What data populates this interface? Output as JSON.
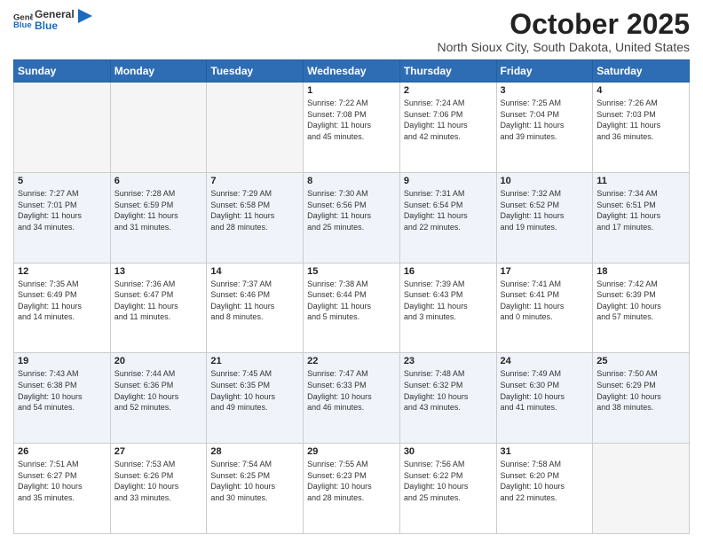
{
  "header": {
    "logo_line1": "General",
    "logo_line2": "Blue",
    "title": "October 2025",
    "subtitle": "North Sioux City, South Dakota, United States"
  },
  "days_of_week": [
    "Sunday",
    "Monday",
    "Tuesday",
    "Wednesday",
    "Thursday",
    "Friday",
    "Saturday"
  ],
  "weeks": [
    [
      {
        "day": "",
        "info": ""
      },
      {
        "day": "",
        "info": ""
      },
      {
        "day": "",
        "info": ""
      },
      {
        "day": "1",
        "info": "Sunrise: 7:22 AM\nSunset: 7:08 PM\nDaylight: 11 hours\nand 45 minutes."
      },
      {
        "day": "2",
        "info": "Sunrise: 7:24 AM\nSunset: 7:06 PM\nDaylight: 11 hours\nand 42 minutes."
      },
      {
        "day": "3",
        "info": "Sunrise: 7:25 AM\nSunset: 7:04 PM\nDaylight: 11 hours\nand 39 minutes."
      },
      {
        "day": "4",
        "info": "Sunrise: 7:26 AM\nSunset: 7:03 PM\nDaylight: 11 hours\nand 36 minutes."
      }
    ],
    [
      {
        "day": "5",
        "info": "Sunrise: 7:27 AM\nSunset: 7:01 PM\nDaylight: 11 hours\nand 34 minutes."
      },
      {
        "day": "6",
        "info": "Sunrise: 7:28 AM\nSunset: 6:59 PM\nDaylight: 11 hours\nand 31 minutes."
      },
      {
        "day": "7",
        "info": "Sunrise: 7:29 AM\nSunset: 6:58 PM\nDaylight: 11 hours\nand 28 minutes."
      },
      {
        "day": "8",
        "info": "Sunrise: 7:30 AM\nSunset: 6:56 PM\nDaylight: 11 hours\nand 25 minutes."
      },
      {
        "day": "9",
        "info": "Sunrise: 7:31 AM\nSunset: 6:54 PM\nDaylight: 11 hours\nand 22 minutes."
      },
      {
        "day": "10",
        "info": "Sunrise: 7:32 AM\nSunset: 6:52 PM\nDaylight: 11 hours\nand 19 minutes."
      },
      {
        "day": "11",
        "info": "Sunrise: 7:34 AM\nSunset: 6:51 PM\nDaylight: 11 hours\nand 17 minutes."
      }
    ],
    [
      {
        "day": "12",
        "info": "Sunrise: 7:35 AM\nSunset: 6:49 PM\nDaylight: 11 hours\nand 14 minutes."
      },
      {
        "day": "13",
        "info": "Sunrise: 7:36 AM\nSunset: 6:47 PM\nDaylight: 11 hours\nand 11 minutes."
      },
      {
        "day": "14",
        "info": "Sunrise: 7:37 AM\nSunset: 6:46 PM\nDaylight: 11 hours\nand 8 minutes."
      },
      {
        "day": "15",
        "info": "Sunrise: 7:38 AM\nSunset: 6:44 PM\nDaylight: 11 hours\nand 5 minutes."
      },
      {
        "day": "16",
        "info": "Sunrise: 7:39 AM\nSunset: 6:43 PM\nDaylight: 11 hours\nand 3 minutes."
      },
      {
        "day": "17",
        "info": "Sunrise: 7:41 AM\nSunset: 6:41 PM\nDaylight: 11 hours\nand 0 minutes."
      },
      {
        "day": "18",
        "info": "Sunrise: 7:42 AM\nSunset: 6:39 PM\nDaylight: 10 hours\nand 57 minutes."
      }
    ],
    [
      {
        "day": "19",
        "info": "Sunrise: 7:43 AM\nSunset: 6:38 PM\nDaylight: 10 hours\nand 54 minutes."
      },
      {
        "day": "20",
        "info": "Sunrise: 7:44 AM\nSunset: 6:36 PM\nDaylight: 10 hours\nand 52 minutes."
      },
      {
        "day": "21",
        "info": "Sunrise: 7:45 AM\nSunset: 6:35 PM\nDaylight: 10 hours\nand 49 minutes."
      },
      {
        "day": "22",
        "info": "Sunrise: 7:47 AM\nSunset: 6:33 PM\nDaylight: 10 hours\nand 46 minutes."
      },
      {
        "day": "23",
        "info": "Sunrise: 7:48 AM\nSunset: 6:32 PM\nDaylight: 10 hours\nand 43 minutes."
      },
      {
        "day": "24",
        "info": "Sunrise: 7:49 AM\nSunset: 6:30 PM\nDaylight: 10 hours\nand 41 minutes."
      },
      {
        "day": "25",
        "info": "Sunrise: 7:50 AM\nSunset: 6:29 PM\nDaylight: 10 hours\nand 38 minutes."
      }
    ],
    [
      {
        "day": "26",
        "info": "Sunrise: 7:51 AM\nSunset: 6:27 PM\nDaylight: 10 hours\nand 35 minutes."
      },
      {
        "day": "27",
        "info": "Sunrise: 7:53 AM\nSunset: 6:26 PM\nDaylight: 10 hours\nand 33 minutes."
      },
      {
        "day": "28",
        "info": "Sunrise: 7:54 AM\nSunset: 6:25 PM\nDaylight: 10 hours\nand 30 minutes."
      },
      {
        "day": "29",
        "info": "Sunrise: 7:55 AM\nSunset: 6:23 PM\nDaylight: 10 hours\nand 28 minutes."
      },
      {
        "day": "30",
        "info": "Sunrise: 7:56 AM\nSunset: 6:22 PM\nDaylight: 10 hours\nand 25 minutes."
      },
      {
        "day": "31",
        "info": "Sunrise: 7:58 AM\nSunset: 6:20 PM\nDaylight: 10 hours\nand 22 minutes."
      },
      {
        "day": "",
        "info": ""
      }
    ]
  ]
}
